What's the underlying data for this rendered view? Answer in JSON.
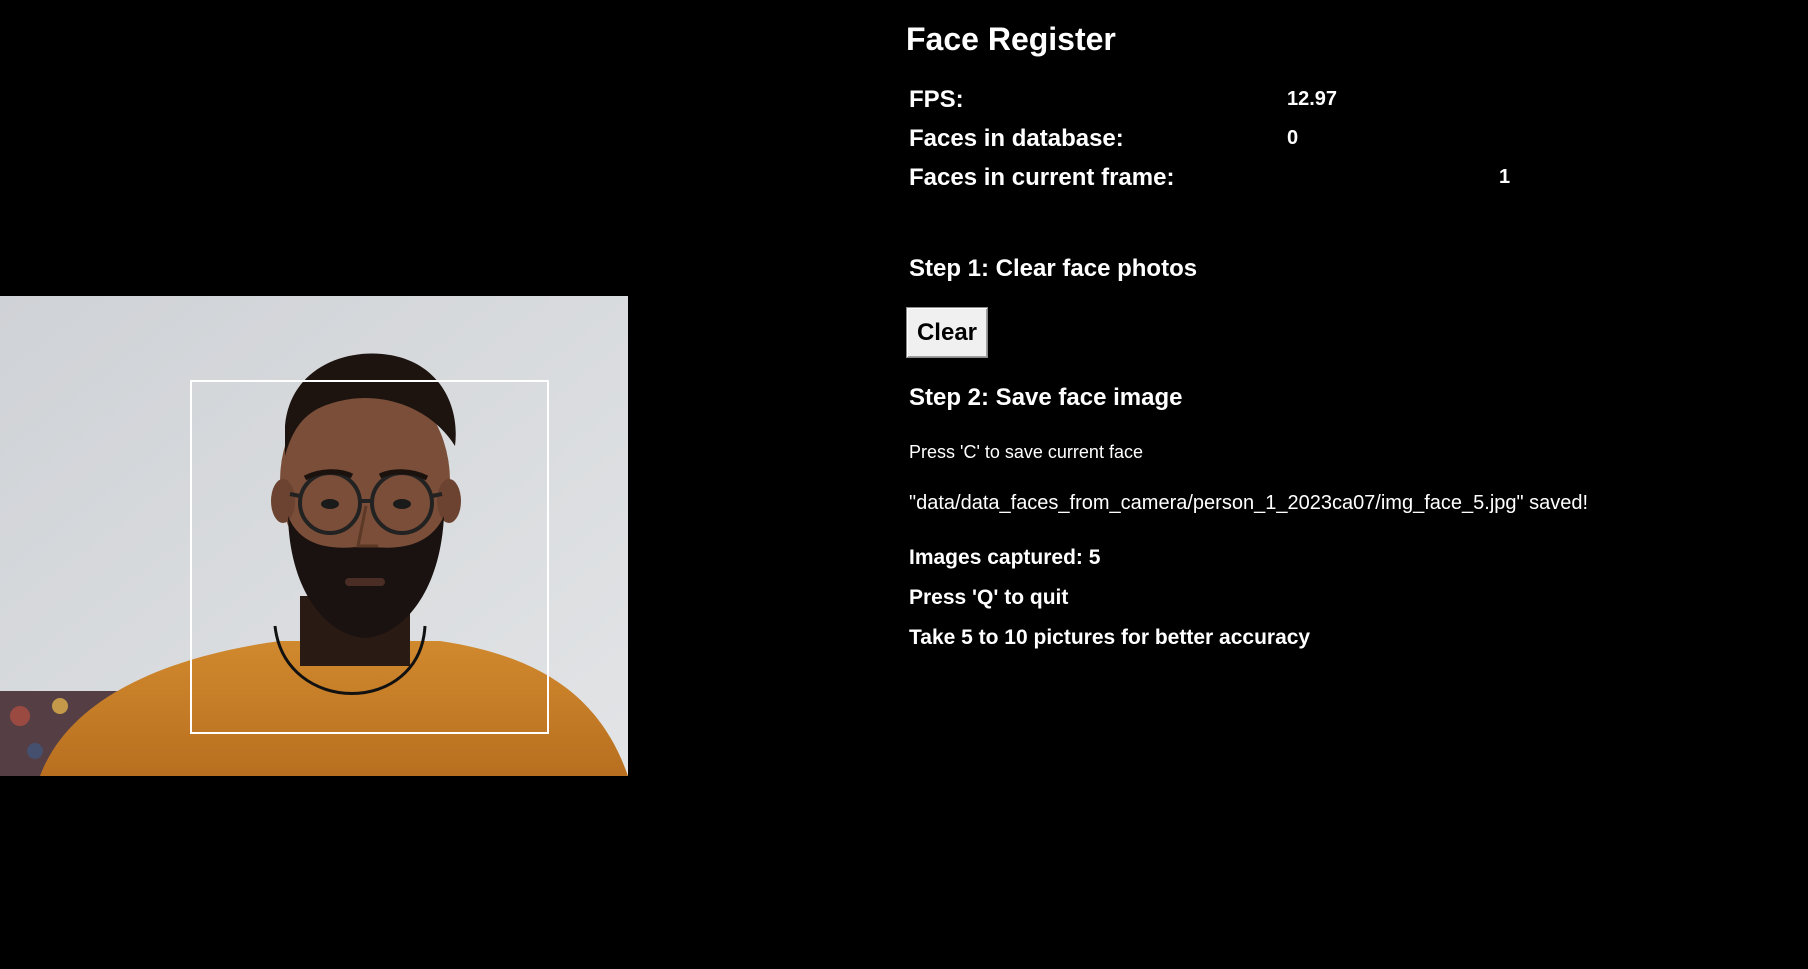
{
  "title": "Face Register",
  "stats": {
    "fps_label": "FPS:",
    "fps_value": "12.97",
    "db_label": "Faces in database:",
    "db_value": "0",
    "frame_label": "Faces in current frame:",
    "frame_value": "1"
  },
  "step1": {
    "label": "Step 1: Clear face photos",
    "button_label": "Clear"
  },
  "step2": {
    "label": "Step 2: Save face image",
    "instruction": "Press 'C' to save current face",
    "saved_message": "\"data/data_faces_from_camera/person_1_2023ca07/img_face_5.jpg\" saved!"
  },
  "info": {
    "images_captured": "Images captured: 5",
    "quit_hint": "Press 'Q' to quit",
    "accuracy_hint": "Take 5 to 10 pictures for better accuracy"
  },
  "colors": {
    "background": "#000000",
    "text": "#ffffff",
    "button_bg": "#f0f0f0",
    "face_box": "#ffffff"
  }
}
